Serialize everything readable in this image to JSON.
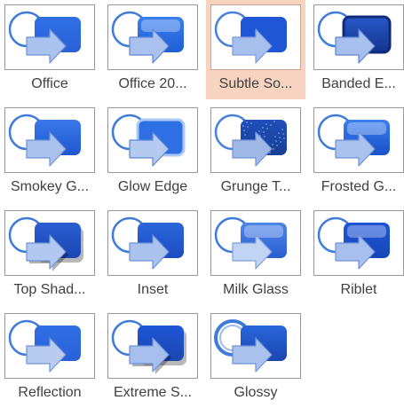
{
  "gallery": {
    "selected_index": 2,
    "items": [
      {
        "label": "Office",
        "style": "office-icon"
      },
      {
        "label": "Office 20...",
        "style": "office-2007-icon"
      },
      {
        "label": "Subtle So...",
        "style": "subtle-solid-icon"
      },
      {
        "label": "Banded E...",
        "style": "banded-edges-icon"
      },
      {
        "label": "Smokey G...",
        "style": "smokey-glass-icon"
      },
      {
        "label": "Glow Edge",
        "style": "glow-edge-icon"
      },
      {
        "label": "Grunge T...",
        "style": "grunge-texture-icon"
      },
      {
        "label": "Frosted G...",
        "style": "frosted-glass-icon"
      },
      {
        "label": "Top Shad...",
        "style": "top-shadow-icon"
      },
      {
        "label": "Inset",
        "style": "inset-icon"
      },
      {
        "label": "Milk Glass",
        "style": "milk-glass-icon"
      },
      {
        "label": "Riblet",
        "style": "riblet-icon"
      },
      {
        "label": "Reflection",
        "style": "reflection-icon"
      },
      {
        "label": "Extreme S...",
        "style": "extreme-shadow-icon"
      },
      {
        "label": "Glossy",
        "style": "glossy-icon"
      }
    ]
  },
  "colors": {
    "selected_background": "#f8d3c0",
    "shape_blue": "#2a6be0",
    "shape_dark_blue": "#1a4fc4",
    "arrow_light": "#a8c0ec",
    "ring": "#3d7ad6",
    "label_text": "#404040"
  }
}
